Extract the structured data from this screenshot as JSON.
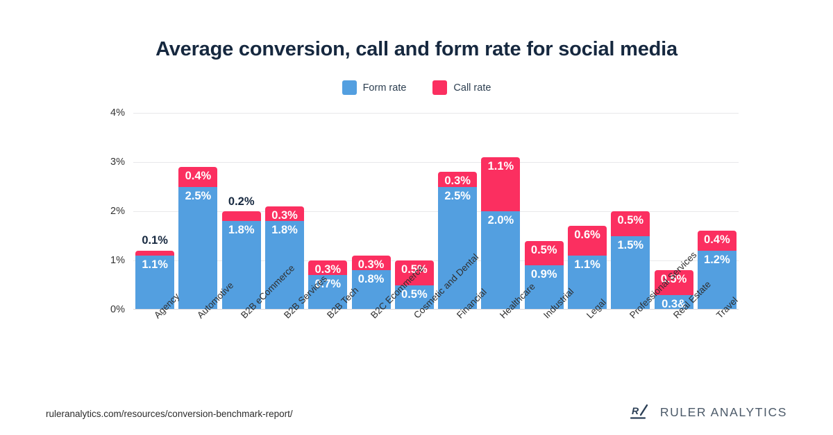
{
  "title": "Average conversion, call and form rate for social media",
  "legend": {
    "position": "top-center",
    "items": [
      {
        "label": "Form rate",
        "color": "#539fe0",
        "key": "form"
      },
      {
        "label": "Call rate",
        "color": "#fb2f60",
        "key": "call"
      }
    ]
  },
  "footer": {
    "url": "ruleranalytics.com/resources/conversion-benchmark-report/",
    "brand": "RULER ANALYTICS",
    "logo_mark": "ruler-r-slash-logo"
  },
  "chart_data": {
    "type": "bar",
    "subtype": "stacked-bar",
    "title": "Average conversion, call and form rate for social media",
    "xlabel": "",
    "ylabel": "",
    "ylim": [
      0,
      4
    ],
    "yticks": [
      "0%",
      "1%",
      "2%",
      "3%",
      "4%"
    ],
    "ytick_values": [
      0,
      1,
      2,
      3,
      4
    ],
    "grid": true,
    "categories": [
      "Agency",
      "Automotive",
      "B2B eCommerce",
      "B2B Services",
      "B2B Tech",
      "B2C Ecommerce",
      "Cosmetic and Dental",
      "Financial",
      "Healthcare",
      "Industrial",
      "Legal",
      "Professional Services",
      "Real Estate",
      "Travel"
    ],
    "series": [
      {
        "name": "Form rate",
        "color": "#539fe0",
        "values": [
          1.1,
          2.5,
          1.8,
          1.8,
          0.7,
          0.8,
          0.5,
          2.5,
          2.0,
          0.9,
          1.1,
          1.5,
          0.3,
          1.2
        ],
        "labels": [
          "1.1%",
          "2.5%",
          "1.8%",
          "1.8%",
          "0.7%",
          "0.8%",
          "0.5%",
          "2.5%",
          "2.0%",
          "0.9%",
          "1.1%",
          "1.5%",
          "0.3&",
          "1.2%"
        ]
      },
      {
        "name": "Call rate",
        "color": "#fb2f60",
        "values": [
          0.1,
          0.4,
          0.2,
          0.3,
          0.3,
          0.3,
          0.5,
          0.3,
          1.1,
          0.5,
          0.6,
          0.5,
          0.5,
          0.4
        ],
        "labels": [
          "0.1%",
          "0.4%",
          "0.2%",
          "0.3%",
          "0.3%",
          "0.3%",
          "0.5%",
          "0.3%",
          "1.1%",
          "0.5%",
          "0.6%",
          "0.5%",
          "0.5%",
          "0.4%"
        ],
        "label_placement": [
          "outside",
          "inside",
          "outside",
          "inside",
          "inside",
          "inside",
          "inside",
          "inside",
          "inside",
          "inside",
          "inside",
          "inside",
          "inside",
          "inside"
        ]
      }
    ],
    "totals": [
      1.2,
      2.9,
      2.0,
      2.1,
      1.0,
      1.1,
      1.0,
      2.8,
      3.1,
      1.4,
      1.7,
      2.0,
      0.8,
      1.6
    ]
  },
  "colors": {
    "form": "#539fe0",
    "call": "#fb2f60",
    "title": "#16283f",
    "grid": "#e8e8ea",
    "text": "#2f2f2f",
    "brand": "#4c5a69"
  }
}
